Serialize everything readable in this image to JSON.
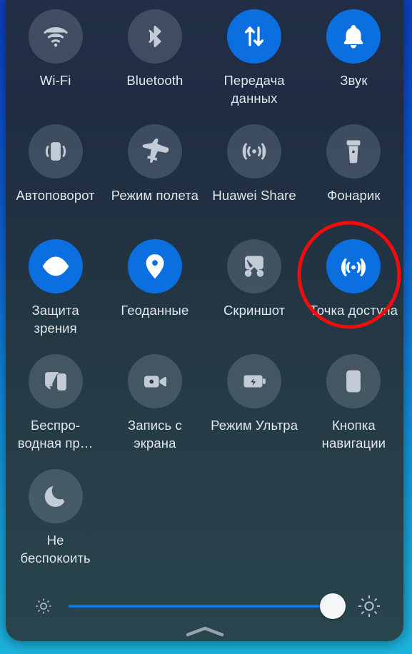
{
  "panel": {
    "name": "quick-settings-shade",
    "colors": {
      "active_toggle": "#0b6fe0",
      "inactive_toggle": "rgba(226,238,248,0.165)",
      "label_text": "#e2e7ec",
      "slider_fill": "#1273e6",
      "slider_knob": "#f4f6f7",
      "annotation": "#f40b0b",
      "wallpaper_top": "#0b3fc4",
      "wallpaper_bottom": "#1bb3dd"
    }
  },
  "toggles": [
    {
      "label": "Wi-Fi",
      "icon": "wifi-icon",
      "state": "off"
    },
    {
      "label": "Bluetooth",
      "icon": "bluetooth-icon",
      "state": "off"
    },
    {
      "label": "Передача данных",
      "icon": "mobile-data-icon",
      "state": "on"
    },
    {
      "label": "Звук",
      "icon": "bell-icon",
      "state": "on"
    },
    {
      "label": "Автоповорот",
      "icon": "auto-rotate-icon",
      "state": "off"
    },
    {
      "label": "Режим полета",
      "icon": "airplane-icon",
      "state": "off"
    },
    {
      "label": "Huawei Share",
      "icon": "huawei-share-icon",
      "state": "off"
    },
    {
      "label": "Фонарик",
      "icon": "flashlight-icon",
      "state": "off"
    },
    {
      "label": "Защита зрения",
      "icon": "eye-comfort-icon",
      "state": "on"
    },
    {
      "label": "Геоданные",
      "icon": "location-pin-icon",
      "state": "on"
    },
    {
      "label": "Скриншот",
      "icon": "screenshot-scissors-icon",
      "state": "off"
    },
    {
      "label": "Точка доступа",
      "icon": "hotspot-icon",
      "state": "on"
    },
    {
      "label": "Беспро-водная пр…",
      "icon": "wireless-projection-icon",
      "state": "off"
    },
    {
      "label": "Запись с экрана",
      "icon": "screen-record-icon",
      "state": "off"
    },
    {
      "label": "Режим Ультра",
      "icon": "battery-ultra-icon",
      "state": "off"
    },
    {
      "label": "Кнопка навигации",
      "icon": "nav-button-icon",
      "state": "off"
    },
    {
      "label": "Не беспокоить",
      "icon": "moon-icon",
      "state": "off"
    }
  ],
  "brightness": {
    "name": "brightness-slider",
    "value_percent": 95,
    "min_icon": "brightness-low-icon",
    "max_icon": "brightness-high-icon"
  },
  "handle": {
    "icon": "chevron-up-icon"
  },
  "annotation": {
    "shape": "ellipse",
    "color": "#f40b0b",
    "stroke_width": 5,
    "targets": "Точка доступа"
  }
}
